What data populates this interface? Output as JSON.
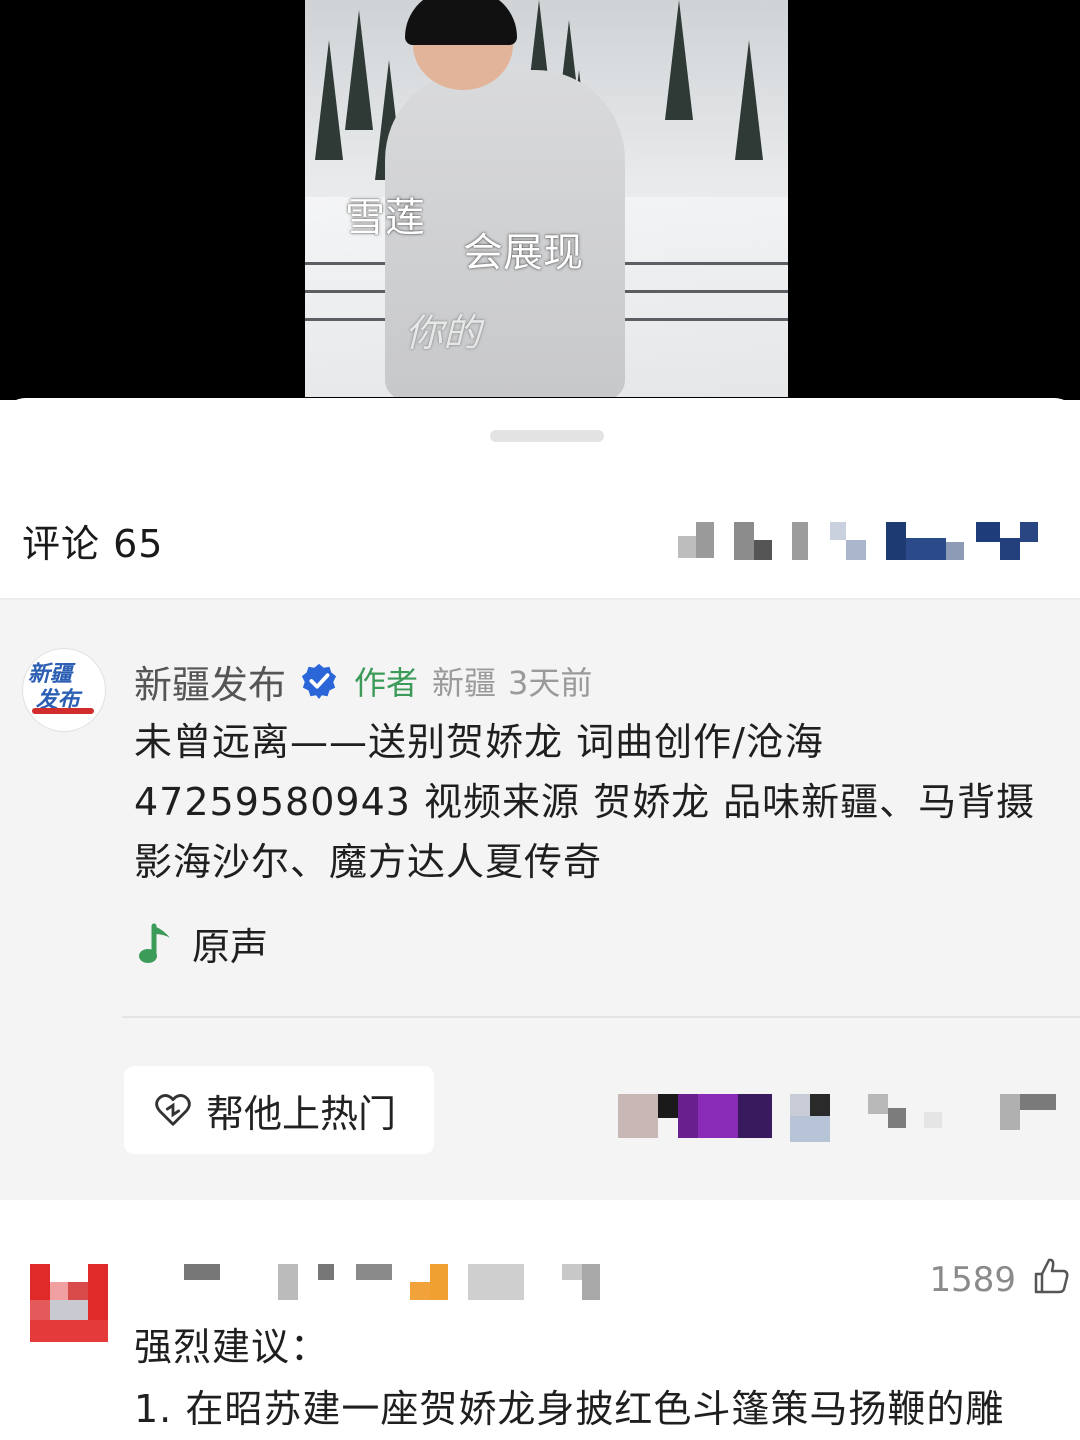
{
  "video": {
    "captions": [
      "雪莲",
      "会展现"
    ],
    "watermark": "你的"
  },
  "comments_header": {
    "title": "评论 65"
  },
  "author_post": {
    "name": "新疆发布",
    "avatar_text": "新疆\n发布",
    "tag": "作者",
    "location": "新疆",
    "time": "3天前",
    "text": "未曾远离——送别贺娇龙 词曲创作/沧海 47259580943 视频来源 贺娇龙 品味新疆、马背摄影海沙尔、魔方达人夏传奇",
    "sound_label": "原声",
    "boost_button": "帮他上热门"
  },
  "comment": {
    "likes": "1589",
    "text": "强烈建议：\n1. 在昭苏建一座贺娇龙身披红色斗篷策马扬鞭的雕"
  },
  "colors": {
    "accent_green": "#3d9b5a",
    "verified_blue": "#2b66d9",
    "block_bg": "#f4f4f4"
  },
  "icons": [
    "verified-icon",
    "music-note-icon",
    "heart-plus-icon",
    "thumbs-up-icon"
  ]
}
